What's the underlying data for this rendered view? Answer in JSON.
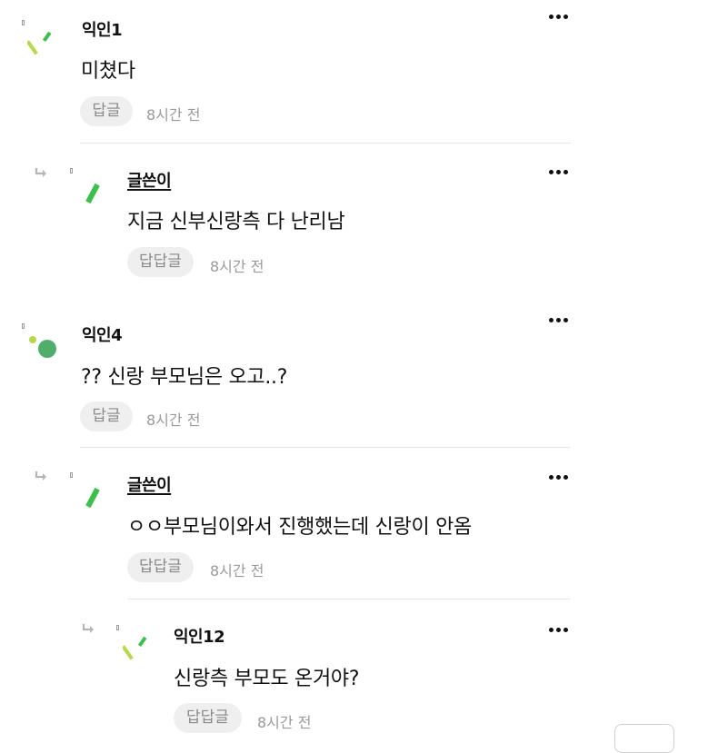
{
  "comments": [
    {
      "author": "익인1",
      "text": "미쳤다",
      "reply_label": "답글",
      "time": "8시간 전"
    },
    {
      "author": "글쓴이",
      "text": "지금 신부신랑측 다 난리남",
      "reply_label": "답답글",
      "time": "8시간 전"
    },
    {
      "author": "익인4",
      "text": "?? 신랑 부모님은 오고..?",
      "reply_label": "답글",
      "time": "8시간 전"
    },
    {
      "author": "글쓴이",
      "text": "ㅇㅇ부모님이와서 진행했는데 신랑이 안옴",
      "reply_label": "답답글",
      "time": "8시간 전"
    },
    {
      "author": "익인12",
      "text": "신랑측 부모도 온거야?",
      "reply_label": "답답글",
      "time": "8시간 전"
    }
  ],
  "icons": {
    "more": "more-options-icon",
    "reply_arrow": "reply-arrow-icon",
    "avatar": "avatar-icon"
  },
  "colors": {
    "avatar_green_dark": "#3cbf4c",
    "avatar_green_light": "#b7d84d",
    "reply_button_bg": "#efefef",
    "muted_text": "#9a9a9a"
  }
}
